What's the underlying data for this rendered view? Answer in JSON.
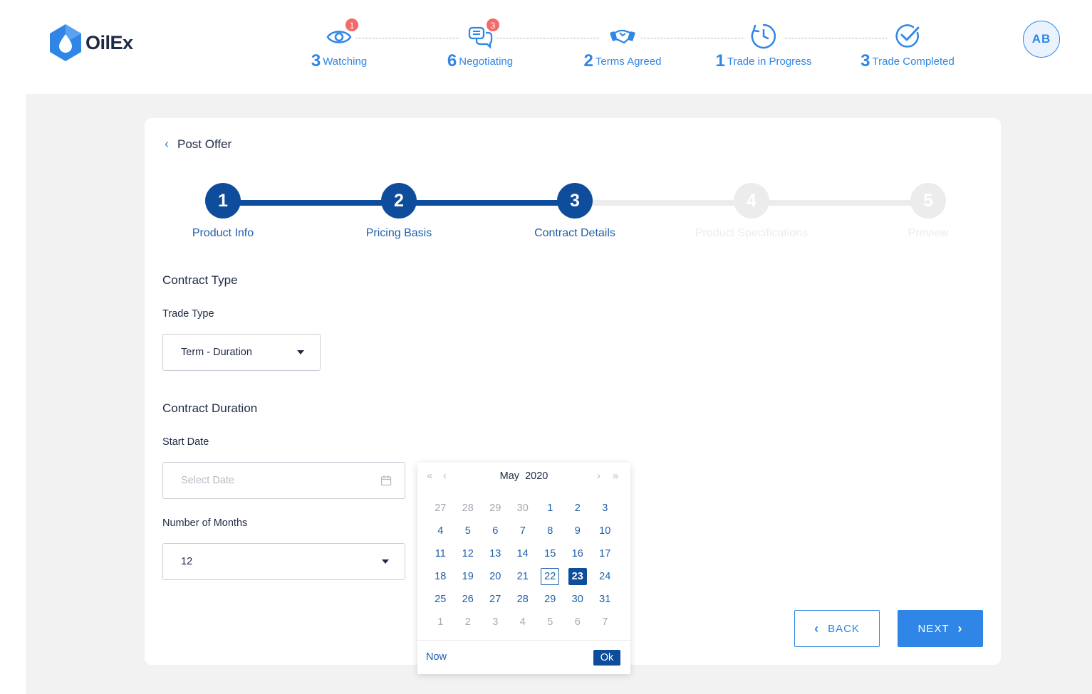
{
  "app": {
    "name": "OilEx"
  },
  "colors": {
    "primary": "#2f86e6",
    "dark_primary": "#0d4d9b",
    "badge": "#f26a6a",
    "background": "#f2f2f2"
  },
  "status_bar": [
    {
      "count": "3",
      "label": "Watching",
      "icon": "eye-icon",
      "badge": "1"
    },
    {
      "count": "6",
      "label": "Negotiating",
      "icon": "chat-icon",
      "badge": "3"
    },
    {
      "count": "2",
      "label": "Terms Agreed",
      "icon": "handshake-icon",
      "badge": ""
    },
    {
      "count": "1",
      "label": "Trade in Progress",
      "icon": "clock-icon",
      "badge": ""
    },
    {
      "count": "3",
      "label": "Trade Completed",
      "icon": "check-circle-icon",
      "badge": ""
    }
  ],
  "user": {
    "initials": "AB"
  },
  "page": {
    "title": "Post Offer"
  },
  "wizard": {
    "steps": [
      {
        "number": "1",
        "label": "Product Info",
        "state": "done"
      },
      {
        "number": "2",
        "label": "Pricing Basis",
        "state": "done"
      },
      {
        "number": "3",
        "label": "Contract Details",
        "state": "current"
      },
      {
        "number": "4",
        "label": "Product Specifications",
        "state": "todo"
      },
      {
        "number": "5",
        "label": "Preview",
        "state": "todo"
      }
    ]
  },
  "form": {
    "contract_type_title": "Contract Type",
    "trade_type_label": "Trade Type",
    "trade_type_value": "Term - Duration",
    "contract_duration_title": "Contract Duration",
    "start_date_label": "Start Date",
    "start_date_placeholder": "Select Date",
    "months_label": "Number of Months",
    "months_value": "12"
  },
  "buttons": {
    "back": "BACK",
    "next": "NEXT"
  },
  "calendar": {
    "month": "May",
    "year": "2020",
    "now_label": "Now",
    "ok_label": "Ok",
    "weeks": [
      [
        {
          "d": "27",
          "m": true
        },
        {
          "d": "28",
          "m": true
        },
        {
          "d": "29",
          "m": true
        },
        {
          "d": "30",
          "m": true
        },
        {
          "d": "1"
        },
        {
          "d": "2"
        },
        {
          "d": "3"
        }
      ],
      [
        {
          "d": "4"
        },
        {
          "d": "5"
        },
        {
          "d": "6"
        },
        {
          "d": "7"
        },
        {
          "d": "8"
        },
        {
          "d": "9"
        },
        {
          "d": "10"
        }
      ],
      [
        {
          "d": "11"
        },
        {
          "d": "12"
        },
        {
          "d": "13"
        },
        {
          "d": "14"
        },
        {
          "d": "15"
        },
        {
          "d": "16"
        },
        {
          "d": "17"
        }
      ],
      [
        {
          "d": "18"
        },
        {
          "d": "19"
        },
        {
          "d": "20"
        },
        {
          "d": "21"
        },
        {
          "d": "22",
          "today": true
        },
        {
          "d": "23",
          "selected": true
        },
        {
          "d": "24"
        }
      ],
      [
        {
          "d": "25"
        },
        {
          "d": "26"
        },
        {
          "d": "27"
        },
        {
          "d": "28"
        },
        {
          "d": "29"
        },
        {
          "d": "30"
        },
        {
          "d": "31"
        }
      ],
      [
        {
          "d": "1",
          "m": true
        },
        {
          "d": "2",
          "m": true
        },
        {
          "d": "3",
          "m": true
        },
        {
          "d": "4",
          "m": true
        },
        {
          "d": "5",
          "m": true
        },
        {
          "d": "6",
          "m": true
        },
        {
          "d": "7",
          "m": true
        }
      ]
    ]
  }
}
